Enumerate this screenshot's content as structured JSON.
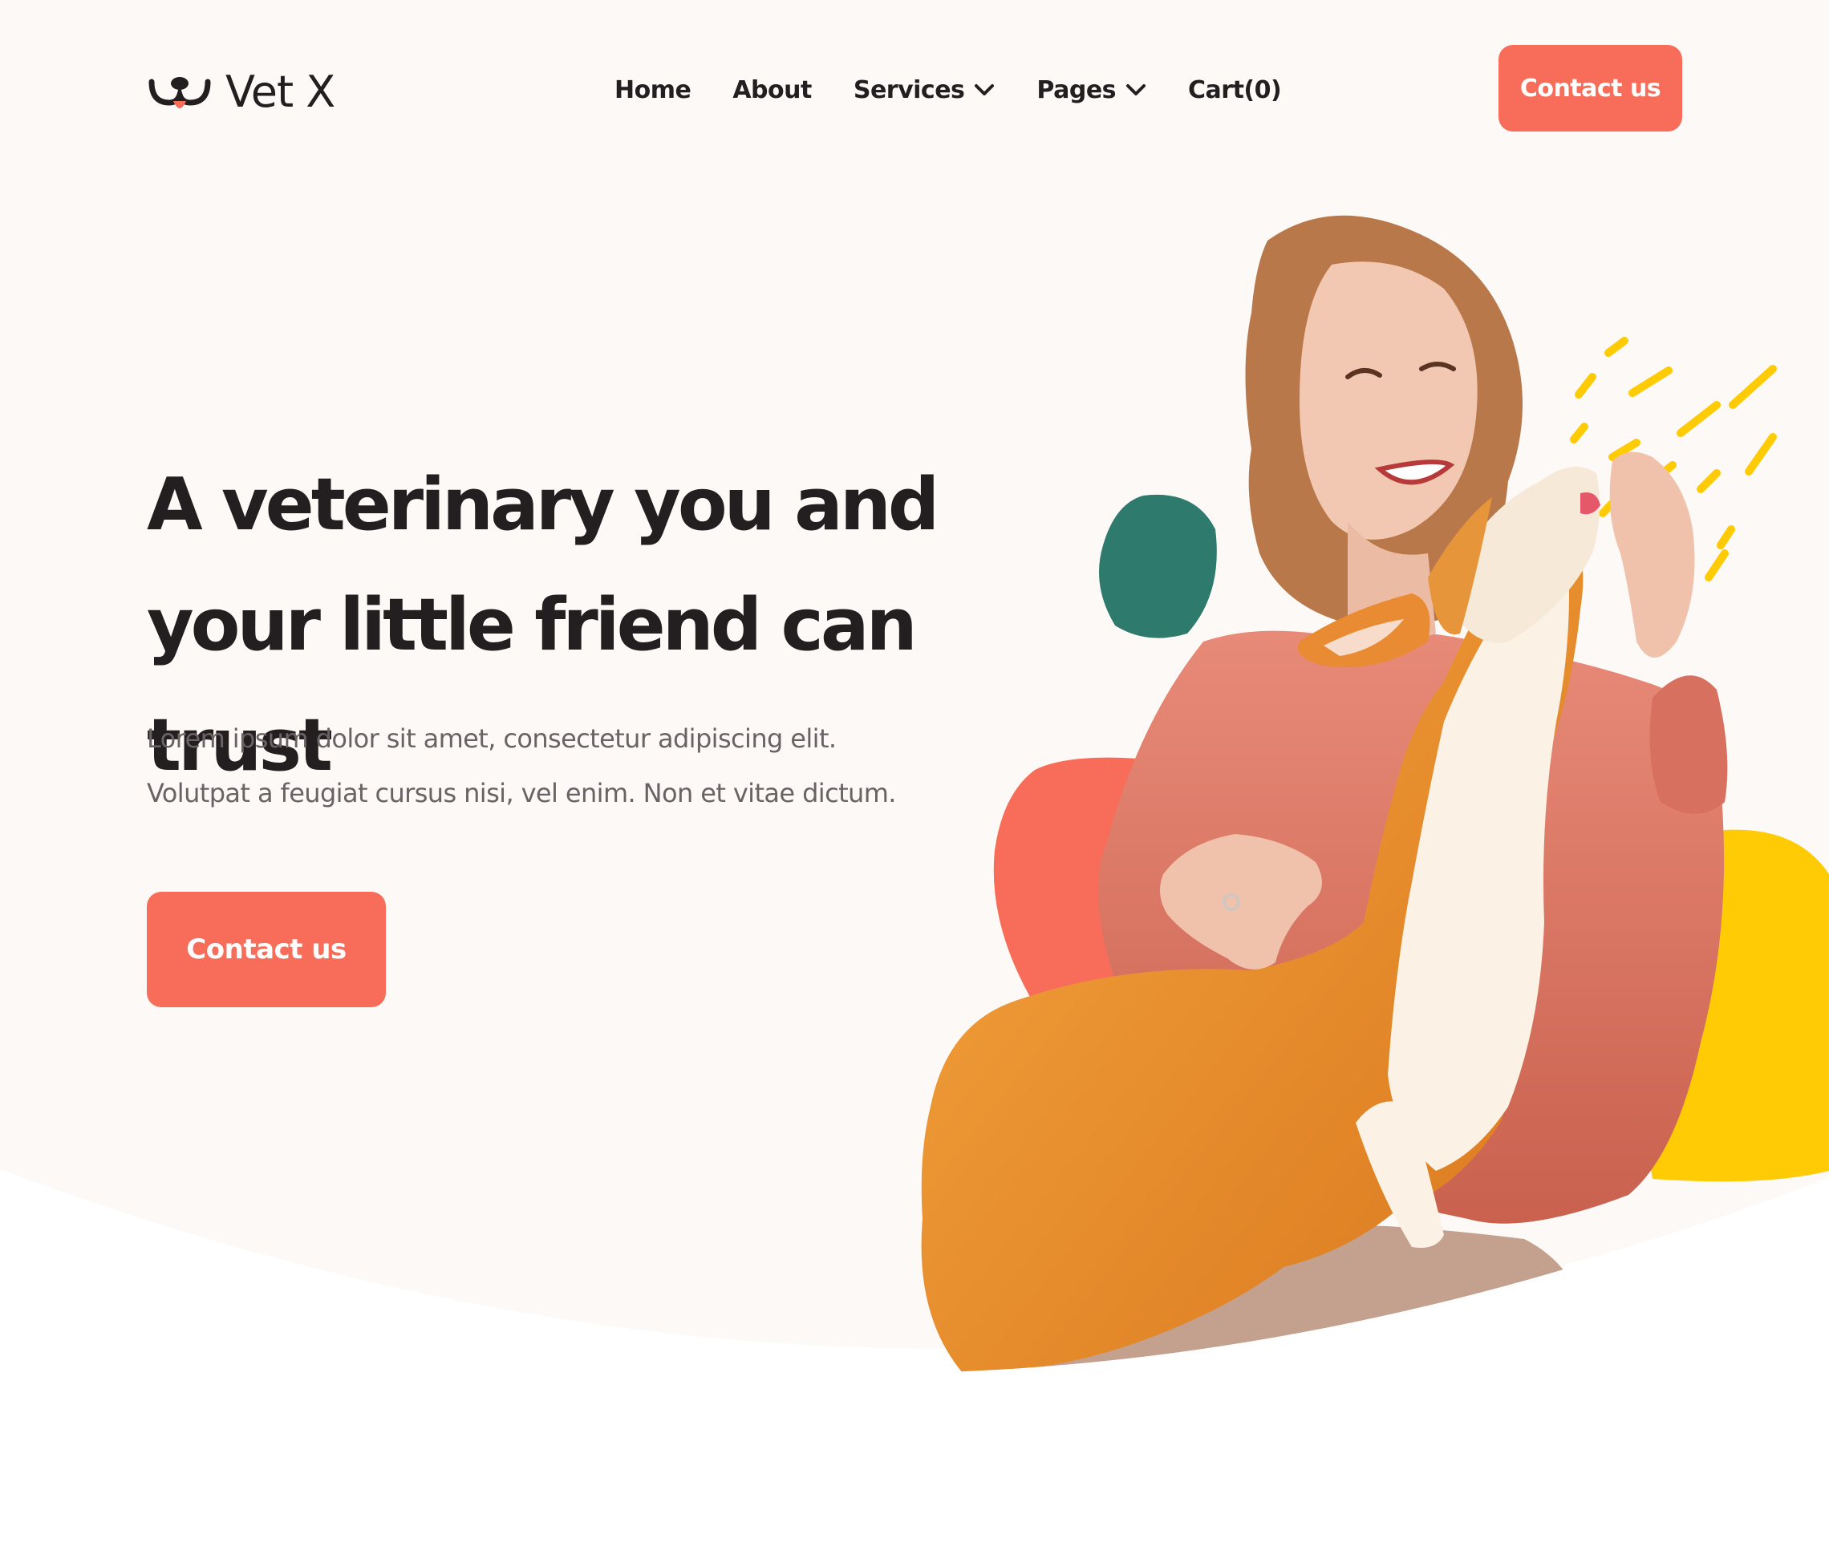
{
  "brand": {
    "name": "Vet X",
    "accent": "#f86d5a",
    "teal": "#2e7a6c",
    "yellow": "#ffcb05",
    "text": "#231f20",
    "muted": "#6a6365",
    "background": "#fdf9f6"
  },
  "nav": {
    "items": [
      {
        "label": "Home",
        "dropdown": false
      },
      {
        "label": "About",
        "dropdown": false
      },
      {
        "label": "Services",
        "dropdown": true
      },
      {
        "label": "Pages",
        "dropdown": true
      },
      {
        "label": "Cart(0)",
        "dropdown": false
      }
    ],
    "dropdown_icon": "chevron-down-icon"
  },
  "header": {
    "cta_label": "Contact us"
  },
  "hero": {
    "title_line1": "A veterinary you and",
    "title_line2": "your little friend can trust",
    "subtitle_line1": "Lorem ipsum dolor sit amet, consectetur adipiscing elit.",
    "subtitle_line2": "Volutpat a feugiat cursus nisi, vel enim. Non et vitae dictum.",
    "cta_label": "Contact us",
    "image": "woman-feeding-corgi-illustration"
  }
}
